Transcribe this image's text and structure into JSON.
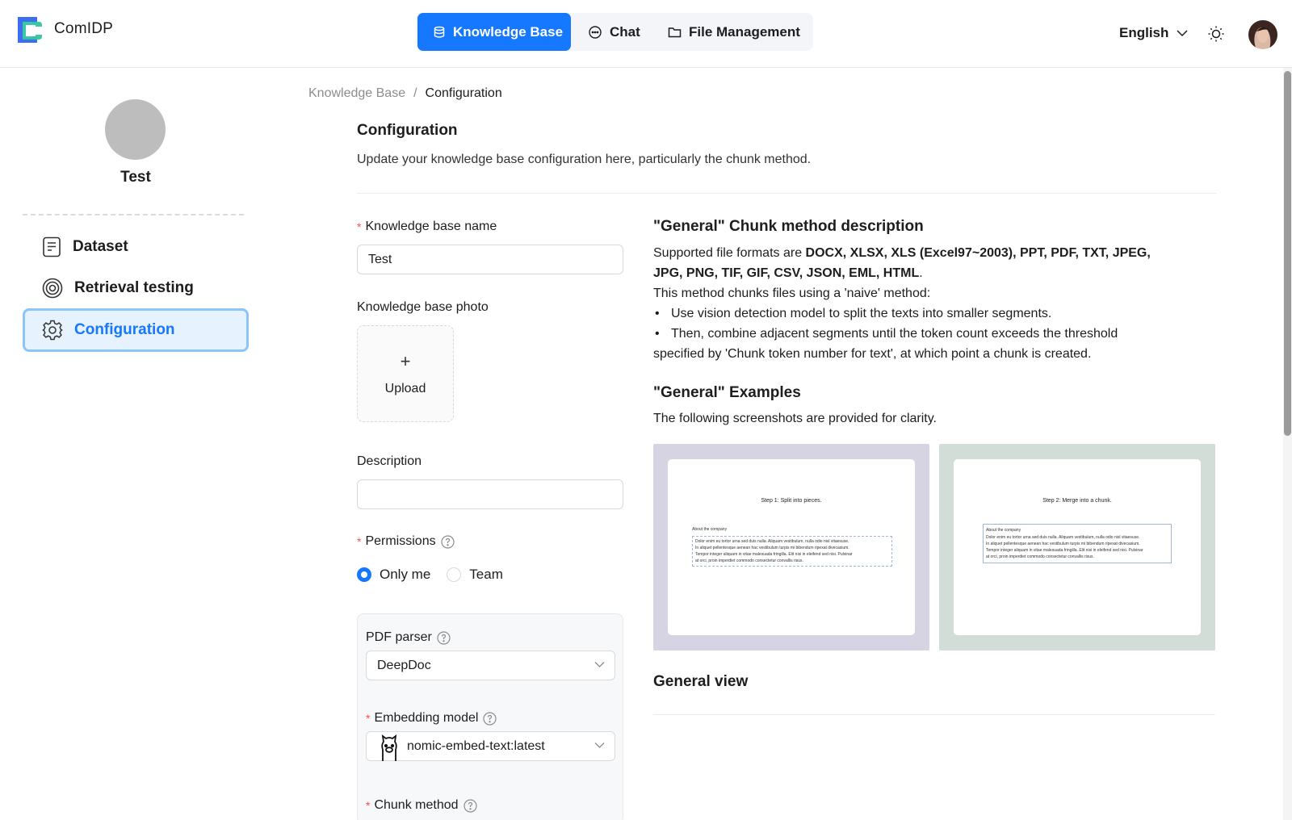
{
  "app": {
    "brand": "ComIDP"
  },
  "nav": {
    "items": [
      {
        "label": "Knowledge Base",
        "icon": "database-icon",
        "active": true
      },
      {
        "label": "Chat",
        "icon": "chat-icon",
        "active": false
      },
      {
        "label": "File Management",
        "icon": "folder-icon",
        "active": false
      }
    ]
  },
  "header": {
    "language": "English",
    "theme_icon": "sun-icon",
    "accent": "#1677ff"
  },
  "sidebar": {
    "kb_name": "Test",
    "items": [
      {
        "label": "Dataset",
        "icon": "document-icon"
      },
      {
        "label": "Retrieval testing",
        "icon": "target-icon"
      },
      {
        "label": "Configuration",
        "icon": "gear-icon",
        "active": true
      }
    ]
  },
  "breadcrumb": {
    "root": "Knowledge Base",
    "separator": "/",
    "current": "Configuration"
  },
  "page": {
    "title": "Configuration",
    "description": "Update your knowledge base configuration here, particularly the chunk method."
  },
  "form": {
    "kb_name_label": "Knowledge base name",
    "kb_name_value": "Test",
    "photo_label": "Knowledge base photo",
    "upload_plus": "+",
    "upload_label": "Upload",
    "description_label": "Description",
    "description_value": "",
    "permissions_label": "Permissions",
    "permission_options": [
      "Only me",
      "Team"
    ],
    "permission_selected": "Only me",
    "pdf_parser_label": "PDF parser",
    "pdf_parser_value": "DeepDoc",
    "embedding_label": "Embedding model",
    "embedding_value": "nomic-embed-text:latest",
    "chunk_method_label": "Chunk method"
  },
  "chunk_desc": {
    "heading": "\"General\" Chunk method description",
    "formats_prefix": "Supported file formats are ",
    "formats_line1": "DOCX, XLSX, XLS (Excel97~2003), PPT, PDF, TXT, JPEG,",
    "formats_line2": "JPG, PNG, TIF, GIF, CSV, JSON, EML, HTML",
    "formats_suffix": ".",
    "method_intro": "This method chunks files using a 'naive' method:",
    "bullet1": "Use vision detection model to split the texts into smaller segments.",
    "bullet2_line1": "Then, combine adjacent segments until the token count exceeds the threshold",
    "bullet2_line2": "specified by 'Chunk token number for text', at which point a chunk is created.",
    "examples_heading": "\"General\" Examples",
    "examples_desc": "The following screenshots are provided for clarity.",
    "example1_step": "Step 1: Split into pieces.",
    "example2_step": "Step 2: Merge into a chunk.",
    "example_section": "About the company",
    "example_text": [
      "Dolor enim eu tortor urna sed duis nulla. Aliquam vestibulum, nulla odio nisl vitaesuse.",
      "In aliquet pellentesque aenean hac vestibulum turpis mi bibendum ripexat divecasium.",
      "Tempor integer aliquam in vitae malesuada fringilla. Elit nisi in eleifend sed nisi. Pulvinar",
      "at orci, proin imperdiet commodo consectetur convallis risus."
    ],
    "example_bg1": "#d6d3e2",
    "example_bg2": "#d3ddd8",
    "general_view": "General view"
  }
}
